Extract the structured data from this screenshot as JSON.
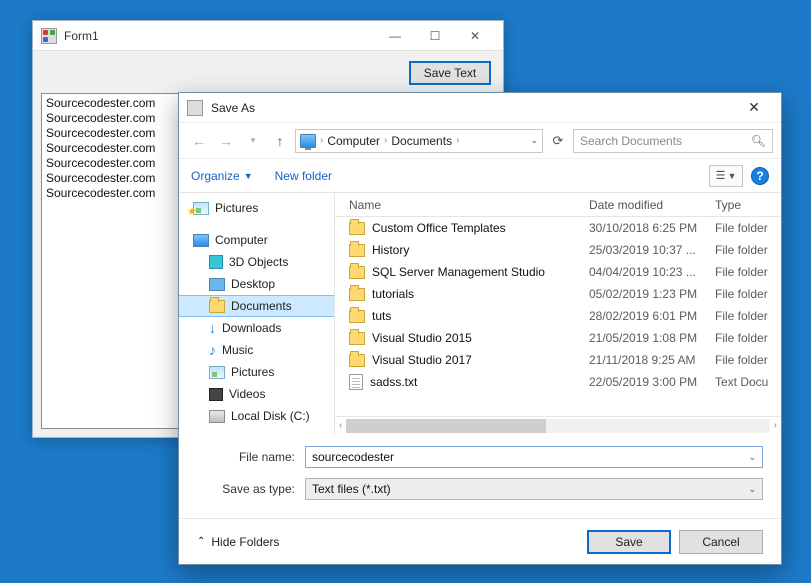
{
  "form1": {
    "title": "Form1",
    "save_btn": "Save Text",
    "list": [
      "Sourcecodester.com",
      "Sourcecodester.com",
      "Sourcecodester.com",
      "Sourcecodester.com",
      "Sourcecodester.com",
      "Sourcecodester.com",
      "Sourcecodester.com"
    ]
  },
  "saveas": {
    "title": "Save As",
    "breadcrumb": {
      "root": "Computer",
      "folder": "Documents"
    },
    "search_placeholder": "Search Documents",
    "organize": "Organize",
    "new_folder": "New folder",
    "columns": {
      "name": "Name",
      "date": "Date modified",
      "type": "Type"
    },
    "tree": {
      "pictures_q": "Pictures",
      "computer": "Computer",
      "objects3d": "3D Objects",
      "desktop": "Desktop",
      "documents": "Documents",
      "downloads": "Downloads",
      "music": "Music",
      "pictures": "Pictures",
      "videos": "Videos",
      "local_disk": "Local Disk (C:)"
    },
    "files": [
      {
        "name": "Custom Office Templates",
        "date": "30/10/2018 6:25 PM",
        "type": "File folder",
        "kind": "folder"
      },
      {
        "name": "History",
        "date": "25/03/2019 10:37 ...",
        "type": "File folder",
        "kind": "folder"
      },
      {
        "name": "SQL Server Management Studio",
        "date": "04/04/2019 10:23 ...",
        "type": "File folder",
        "kind": "folder"
      },
      {
        "name": "tutorials",
        "date": "05/02/2019 1:23 PM",
        "type": "File folder",
        "kind": "folder"
      },
      {
        "name": "tuts",
        "date": "28/02/2019 6:01 PM",
        "type": "File folder",
        "kind": "folder"
      },
      {
        "name": "Visual Studio 2015",
        "date": "21/05/2019 1:08 PM",
        "type": "File folder",
        "kind": "folder"
      },
      {
        "name": "Visual Studio 2017",
        "date": "21/11/2018 9:25 AM",
        "type": "File folder",
        "kind": "folder"
      },
      {
        "name": "sadss.txt",
        "date": "22/05/2019 3:00 PM",
        "type": "Text Docu",
        "kind": "txt"
      }
    ],
    "file_name_label": "File name:",
    "file_name_value": "sourcecodester",
    "save_type_label": "Save as type:",
    "save_type_value": "Text files (*.txt)",
    "hide_folders": "Hide Folders",
    "save_btn": "Save",
    "cancel_btn": "Cancel"
  }
}
